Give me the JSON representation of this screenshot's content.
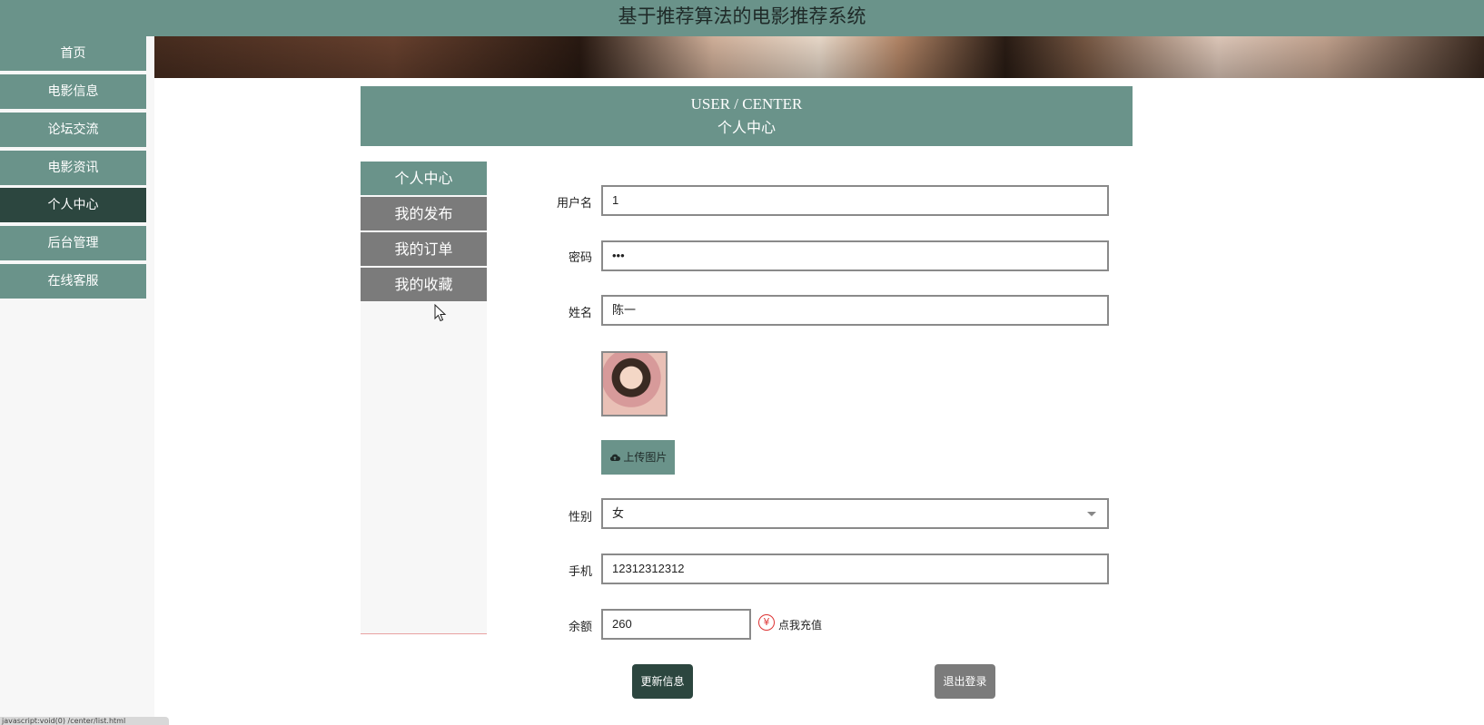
{
  "header": {
    "title": "基于推荐算法的电影推荐系统"
  },
  "sidebar": {
    "items": [
      {
        "label": "首页"
      },
      {
        "label": "电影信息"
      },
      {
        "label": "论坛交流"
      },
      {
        "label": "电影资讯"
      },
      {
        "label": "个人中心",
        "active": true
      },
      {
        "label": "后台管理"
      },
      {
        "label": "在线客服"
      }
    ]
  },
  "user_center": {
    "title_en": "USER / CENTER",
    "title_zh": "个人中心"
  },
  "sub_nav": {
    "items": [
      {
        "label": "个人中心",
        "active": true
      },
      {
        "label": "我的发布"
      },
      {
        "label": "我的订单"
      },
      {
        "label": "我的收藏"
      }
    ]
  },
  "form": {
    "username": {
      "label": "用户名",
      "value": "1"
    },
    "password": {
      "label": "密码",
      "value": "•••"
    },
    "name": {
      "label": "姓名",
      "value": "陈一"
    },
    "upload_label": "上传图片",
    "gender": {
      "label": "性别",
      "value": "女"
    },
    "phone": {
      "label": "手机",
      "value": "12312312312"
    },
    "balance": {
      "label": "余额",
      "value": "260",
      "recharge_label": "点我充值"
    },
    "update_button": "更新信息",
    "logout_button": "退出登录"
  },
  "status_bar": {
    "text": "javascript:void(0)  /center/list.html"
  },
  "colors": {
    "primary": "#6a938a",
    "active": "#2c463f",
    "gray": "#7b7b7b"
  },
  "icons": {
    "upload": "cloud-upload-icon",
    "recharge": "yen-icon"
  }
}
